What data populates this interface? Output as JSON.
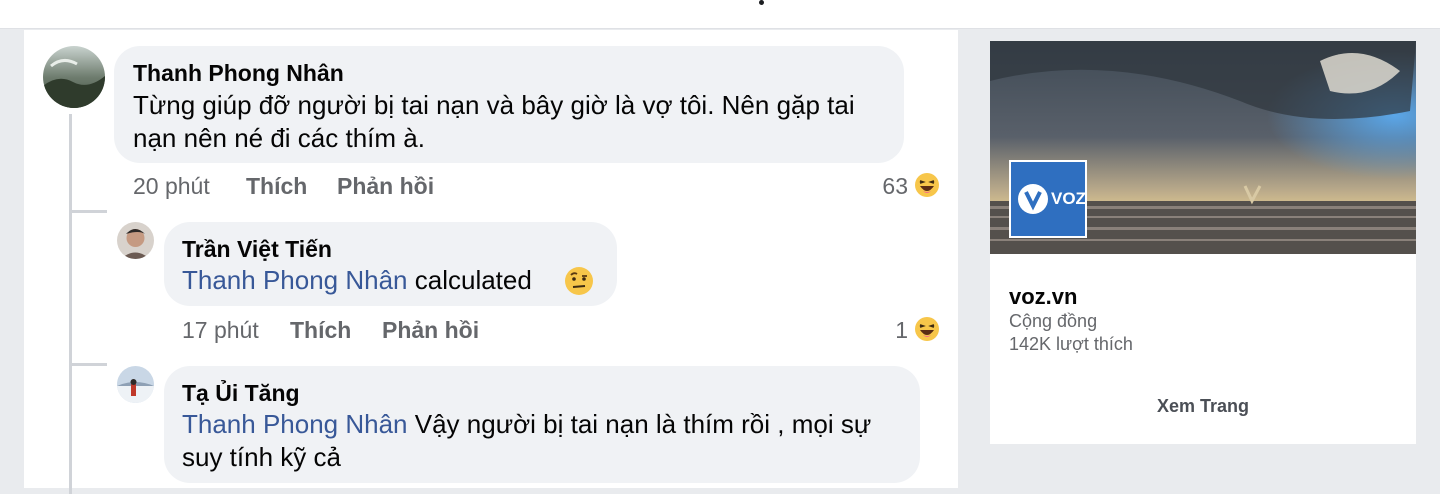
{
  "comments": [
    {
      "author": "Thanh Phong Nhân",
      "text": "Từng giúp đỡ người bị tai nạn và bây giờ là vợ tôi. Nên gặp tai nạn nên né đi các thím à.",
      "time": "20 phút",
      "like_label": "Thích",
      "reply_label": "Phản hồi",
      "reaction_count": "63",
      "reaction_icon": "haha-emoji-icon"
    }
  ],
  "replies": [
    {
      "author": "Trần Việt Tiến",
      "mention": "Thanh Phong Nhân",
      "text": "calculated",
      "inline_emoji": "raised-eyebrow-emoji-icon",
      "time": "17 phút",
      "like_label": "Thích",
      "reply_label": "Phản hồi",
      "reaction_count": "1",
      "reaction_icon": "haha-emoji-icon"
    },
    {
      "author": "Tạ Ủi Tăng",
      "mention": "Thanh Phong Nhân",
      "text": "Vậy người bị tai nạn là thím rồi , mọi sự suy tính kỹ cả"
    }
  ],
  "page_card": {
    "logo_text": "VOZ",
    "name": "voz.vn",
    "category": "Cộng đồng",
    "likes": "142K lượt thích",
    "button_label": "Xem Trang"
  },
  "colors": {
    "mention": "#385898",
    "bubble": "#f0f2f5",
    "logo_bg": "#2f6fc0"
  }
}
